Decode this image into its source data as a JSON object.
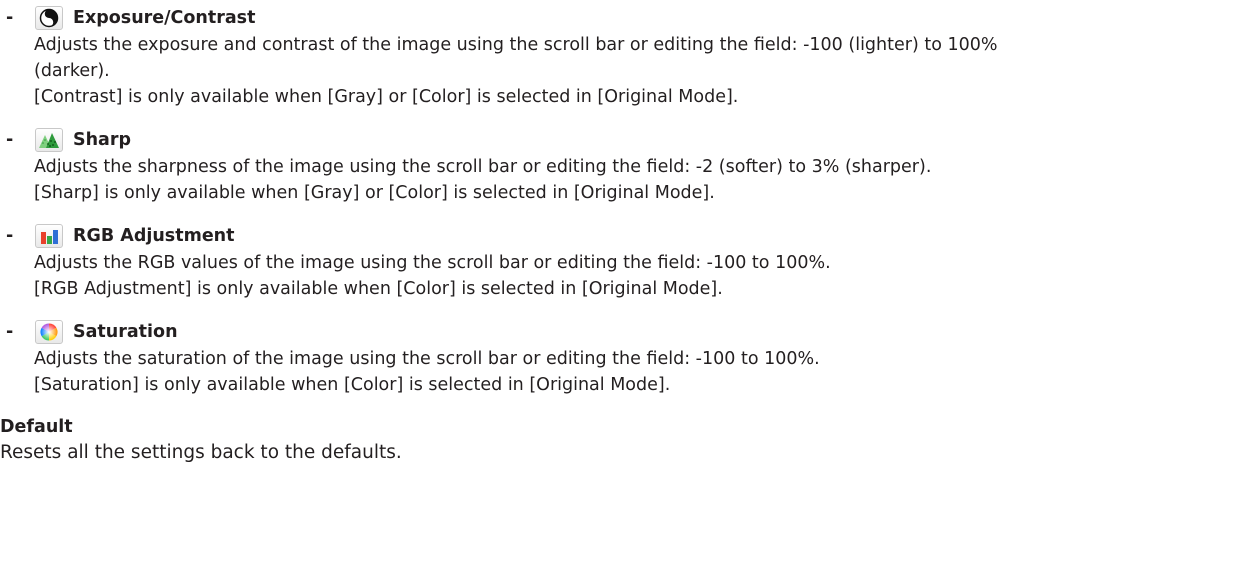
{
  "items": [
    {
      "bullet": "-",
      "icon": "exposure-contrast-icon",
      "title": "Exposure/Contrast",
      "desc_lines": [
        "Adjusts the exposure and contrast of the image using the scroll bar or editing the field: -100 (lighter) to 100%",
        "(darker).",
        "[Contrast] is only available when [Gray] or [Color] is selected in [Original Mode]."
      ]
    },
    {
      "bullet": "-",
      "icon": "sharp-icon",
      "title": "Sharp",
      "desc_lines": [
        "Adjusts the sharpness of the image using the scroll bar or editing the field: -2 (softer) to 3% (sharper).",
        "[Sharp] is only available when [Gray] or [Color] is selected in [Original Mode]."
      ]
    },
    {
      "bullet": "-",
      "icon": "rgb-adjustment-icon",
      "title": "RGB Adjustment",
      "desc_lines": [
        "Adjusts the RGB values of the image using the scroll bar or editing the field: -100 to 100%.",
        "[RGB Adjustment] is only available when [Color] is selected in [Original Mode]."
      ]
    },
    {
      "bullet": "-",
      "icon": "saturation-icon",
      "title": "Saturation",
      "desc_lines": [
        "Adjusts the saturation of the image using the scroll bar or editing the field: -100 to 100%.",
        "[Saturation] is only available when [Color] is selected in [Original Mode]."
      ]
    }
  ],
  "default": {
    "title": "Default",
    "desc": "Resets all the settings back to the defaults."
  }
}
